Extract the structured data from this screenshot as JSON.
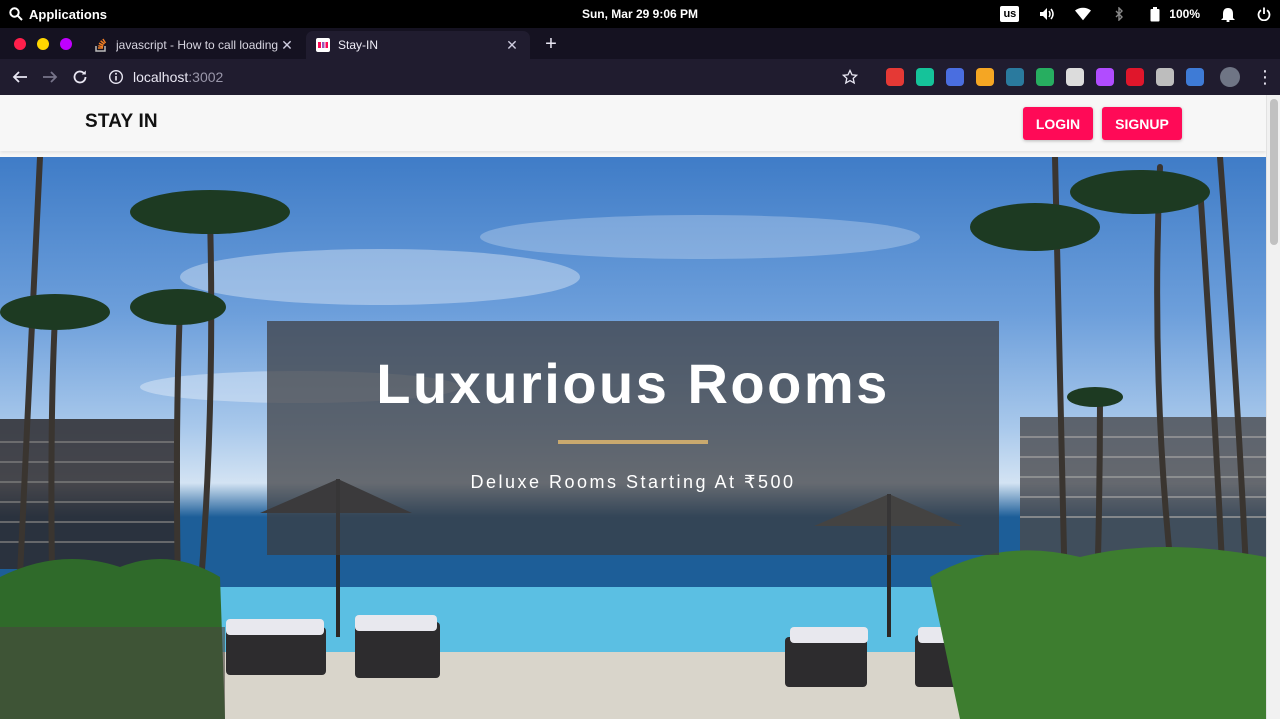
{
  "os_bar": {
    "apps_label": "Applications",
    "clock": "Sun, Mar 29   9:06 PM",
    "keyboard_layout": "us",
    "battery": "100%",
    "icons": [
      "search-icon",
      "volume-icon",
      "wifi-icon",
      "bluetooth-icon",
      "battery-icon",
      "bell-icon",
      "power-icon"
    ]
  },
  "browser": {
    "tabs": [
      {
        "title": "javascript - How to call loading",
        "favicon": "stackoverflow-icon",
        "active": false
      },
      {
        "title": "Stay-IN",
        "favicon": "site-favicon",
        "active": true
      }
    ],
    "new_tab_glyph": "+",
    "address": {
      "host": "localhost",
      "port": ":3002"
    },
    "extensions": [
      {
        "name": "ext-red",
        "color": "#e53935"
      },
      {
        "name": "grammarly",
        "color": "#15c39a"
      },
      {
        "name": "translate",
        "color": "#4a6ee0"
      },
      {
        "name": "ext-orange",
        "color": "#f5a623"
      },
      {
        "name": "ext-pen",
        "color": "#2a7a9e"
      },
      {
        "name": "ext-green",
        "color": "#27ae60"
      },
      {
        "name": "ext-s",
        "color": "#dcdcdc"
      },
      {
        "name": "ext-feather",
        "color": "#b14cff"
      },
      {
        "name": "ext-hand",
        "color": "#e0162b"
      },
      {
        "name": "ext-target",
        "color": "#bdbdbd"
      },
      {
        "name": "ext-box",
        "color": "#3e7bd6"
      }
    ],
    "accent": "#201c2f"
  },
  "site": {
    "brand": "STAY IN",
    "nav": {
      "login_label": "LOGIN",
      "signup_label": "SIGNUP"
    },
    "hero": {
      "title": "Luxurious Rooms",
      "subtitle": "Deluxe Rooms Starting At ₹500",
      "divider_color": "#c9a96e"
    },
    "button_color": "#ff0a57"
  }
}
